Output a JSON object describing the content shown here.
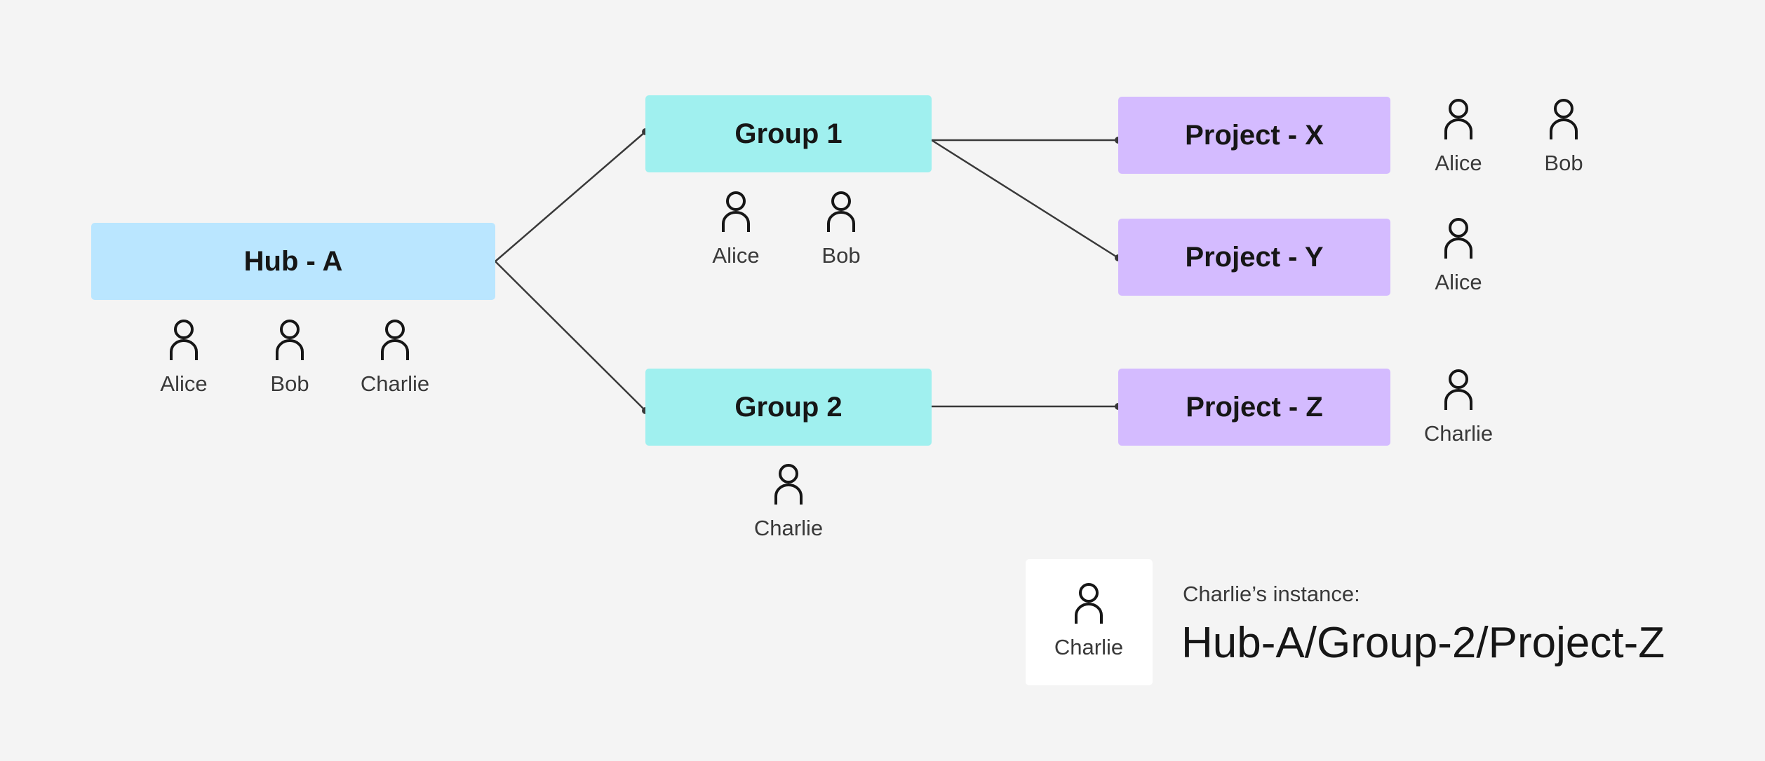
{
  "nodes": {
    "hub_a": {
      "label": "Hub - A",
      "members": [
        "Alice",
        "Bob",
        "Charlie"
      ]
    },
    "group_1": {
      "label": "Group 1",
      "members": [
        "Alice",
        "Bob"
      ]
    },
    "group_2": {
      "label": "Group 2",
      "members": [
        "Charlie"
      ]
    },
    "project_x": {
      "label": "Project - X",
      "members": [
        "Alice",
        "Bob"
      ]
    },
    "project_y": {
      "label": "Project - Y",
      "members": [
        "Alice"
      ]
    },
    "project_z": {
      "label": "Project - Z",
      "members": [
        "Charlie"
      ]
    }
  },
  "edges": [
    {
      "from": "Hub - A",
      "to": "Group 1"
    },
    {
      "from": "Hub - A",
      "to": "Group 2"
    },
    {
      "from": "Group 1",
      "to": "Project - X"
    },
    {
      "from": "Group 1",
      "to": "Project - Y"
    },
    {
      "from": "Group 2",
      "to": "Project - Z"
    }
  ],
  "legend": {
    "user": "Charlie",
    "caption": "Charlie’s instance:",
    "path": "Hub-A/Group-2/Project-Z"
  },
  "icons": {
    "person": "user-icon"
  },
  "colors": {
    "background": "#f4f4f4",
    "hub": "#bae6ff",
    "group": "#a0f0ef",
    "project": "#d4bbff",
    "connector": "#393939",
    "text": "#161616"
  }
}
